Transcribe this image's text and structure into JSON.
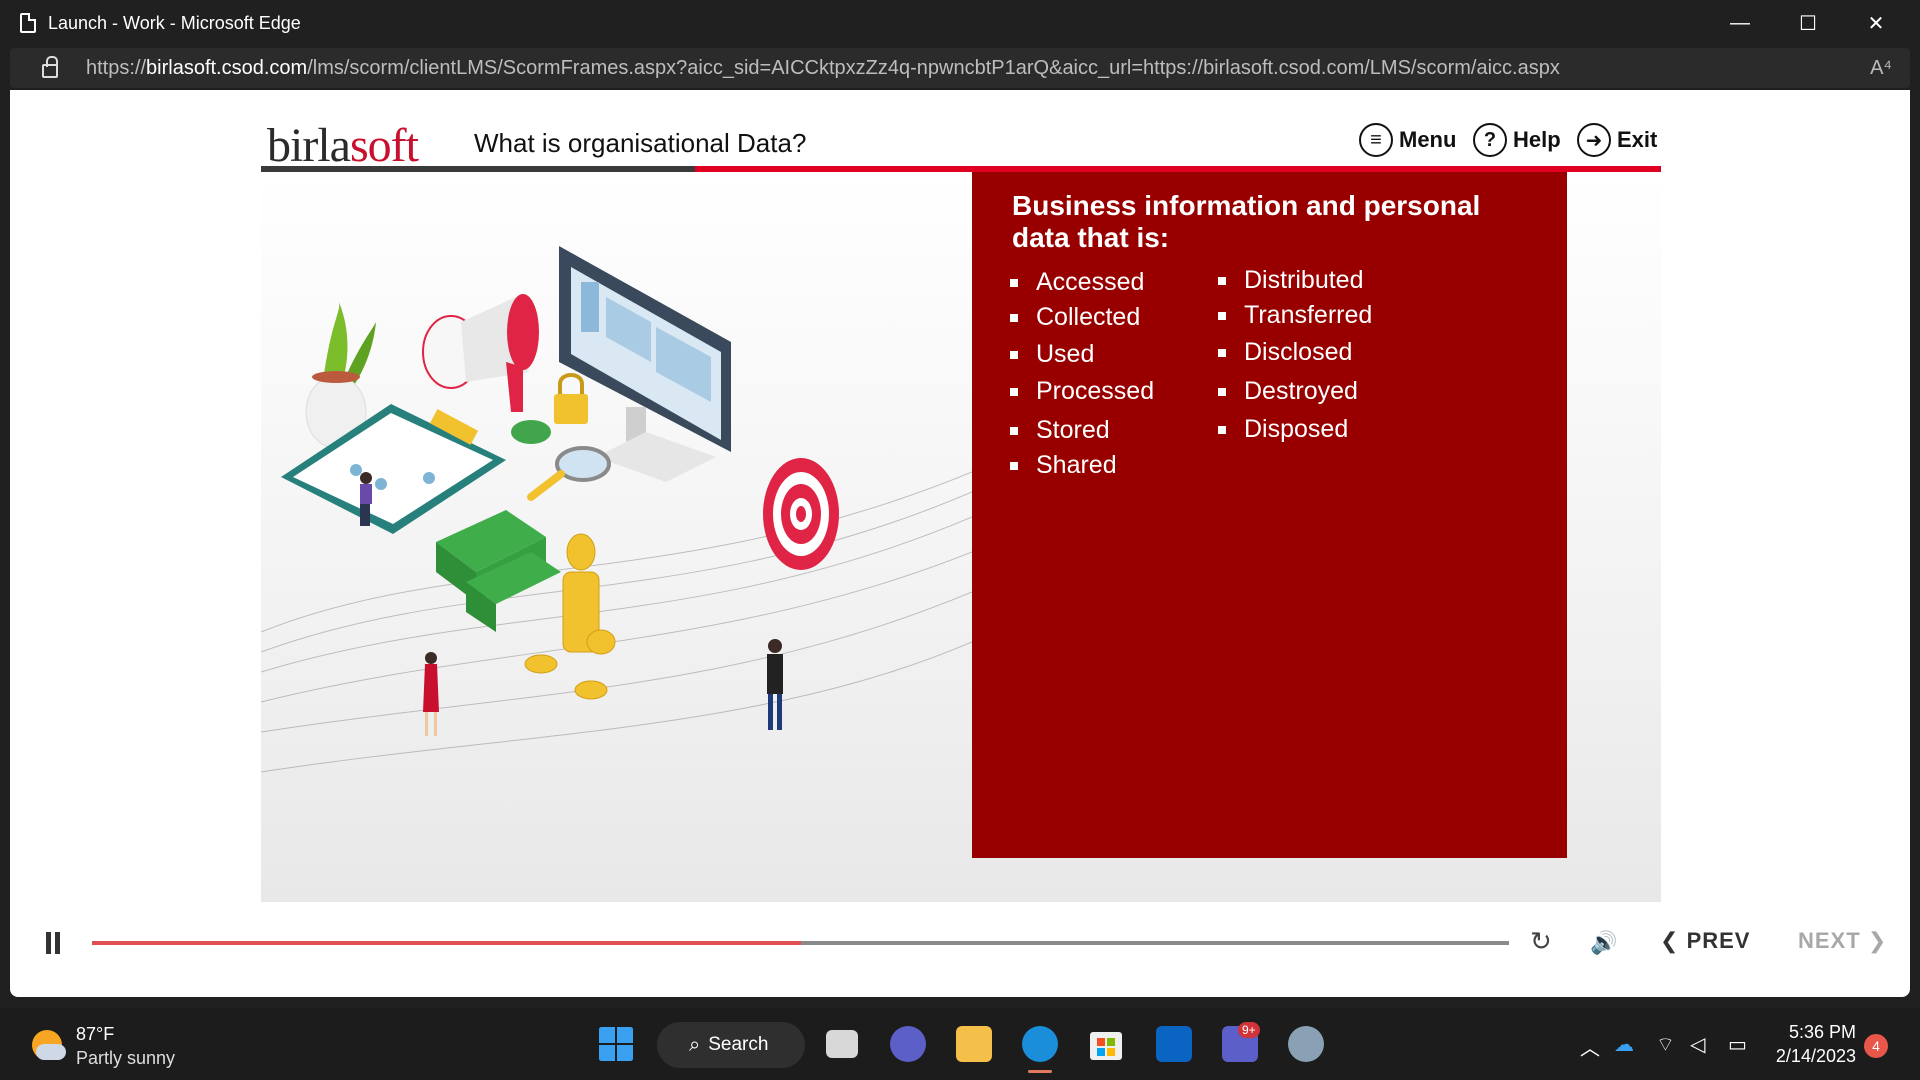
{
  "window": {
    "title": "Launch - Work - Microsoft Edge",
    "minimize": "—",
    "maximize": "☐",
    "close": "✕"
  },
  "addressbar": {
    "url_prefix": "https://",
    "url_domain": "birlasoft.csod.com",
    "url_path": "/lms/scorm/clientLMS/ScormFrames.aspx?aicc_sid=AICCktpxzZz4q-npwncbtP1arQ&aicc_url=https://birlasoft.csod.com/LMS/scorm/aicc.aspx",
    "read_aloud": "A⁴"
  },
  "course": {
    "logo_part1": "birla",
    "logo_part2": "soft",
    "title": "What is organisational Data?",
    "menu_label": "Menu",
    "help_label": "Help",
    "exit_label": "Exit",
    "menu_icon": "≡",
    "help_icon": "?",
    "exit_icon": "➜"
  },
  "slide": {
    "panel_title": "Business information and personal data that is:",
    "left_list": [
      "Accessed",
      "Collected",
      "Used",
      "Processed",
      "Stored",
      "Shared"
    ],
    "right_list": [
      "Distributed",
      "Transferred",
      "Disclosed",
      "Destroyed",
      "Disposed"
    ]
  },
  "playbar": {
    "progress": 0.5,
    "prev_label": "PREV",
    "next_label": "NEXT",
    "replay_icon": "↻",
    "volume_icon": "🔊",
    "prev_chevron": "❮",
    "next_chevron": "❯"
  },
  "taskbar": {
    "temperature": "87°F",
    "weather": "Partly sunny",
    "search_label": "Search",
    "time": "5:36 PM",
    "date": "2/14/2023",
    "notifications": "4",
    "teams_badge": "9+",
    "colors": {
      "edge": "#1a8ed8",
      "accent_red": "#e00022",
      "panel_red": "#980000"
    }
  }
}
